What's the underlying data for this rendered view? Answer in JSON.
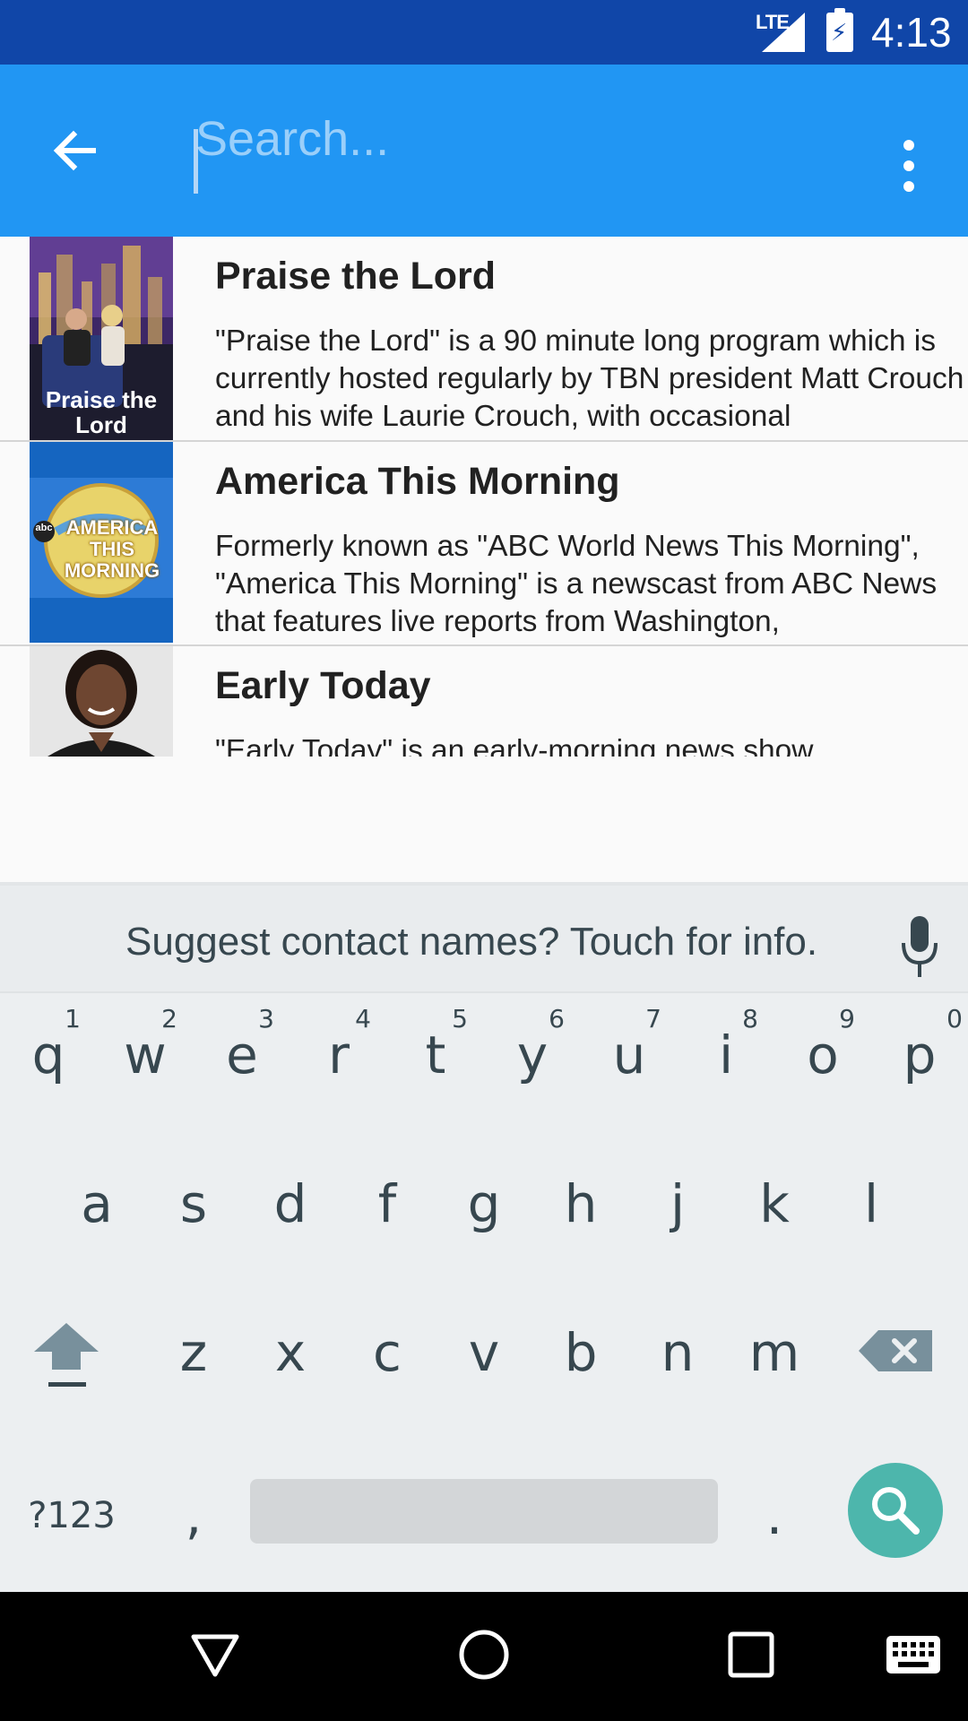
{
  "status_bar": {
    "network": "LTE",
    "time": "4:13",
    "icons": [
      "signal-icon",
      "battery-charging-icon"
    ]
  },
  "app_bar": {
    "search_placeholder": "Search...",
    "icons": [
      "back-arrow-icon",
      "more-vert-icon"
    ]
  },
  "results": [
    {
      "title": "Praise the Lord",
      "thumb_caption": "Praise the Lord",
      "description": "\"Praise the Lord\" is a 90 minute long program which is currently hosted regularly by TBN president Matt Crouch and his wife Laurie Crouch, with occasional"
    },
    {
      "title": "America This Morning",
      "thumb_caption": "AMERICA THIS MORNING",
      "thumb_logo": "abc",
      "description": "Formerly known as \"ABC World News This Morning\", \"America This Morning\" is a newscast from ABC News that features live reports from Washington,"
    },
    {
      "title": "Early Today",
      "description": "\"Early Today\" is an early-morning news show"
    }
  ],
  "keyboard": {
    "suggestion": "Suggest contact names? Touch for info.",
    "row1": [
      {
        "ch": "q",
        "num": "1"
      },
      {
        "ch": "w",
        "num": "2"
      },
      {
        "ch": "e",
        "num": "3"
      },
      {
        "ch": "r",
        "num": "4"
      },
      {
        "ch": "t",
        "num": "5"
      },
      {
        "ch": "y",
        "num": "6"
      },
      {
        "ch": "u",
        "num": "7"
      },
      {
        "ch": "i",
        "num": "8"
      },
      {
        "ch": "o",
        "num": "9"
      },
      {
        "ch": "p",
        "num": "0"
      }
    ],
    "row2": [
      "a",
      "s",
      "d",
      "f",
      "g",
      "h",
      "j",
      "k",
      "l"
    ],
    "row3": [
      "z",
      "x",
      "c",
      "v",
      "b",
      "n",
      "m"
    ],
    "symbols_label": "?123",
    "comma": ",",
    "period": ".",
    "accent_color": "#4db6ac"
  },
  "colors": {
    "status_bar": "#1046a8",
    "app_bar": "#2196f3"
  }
}
